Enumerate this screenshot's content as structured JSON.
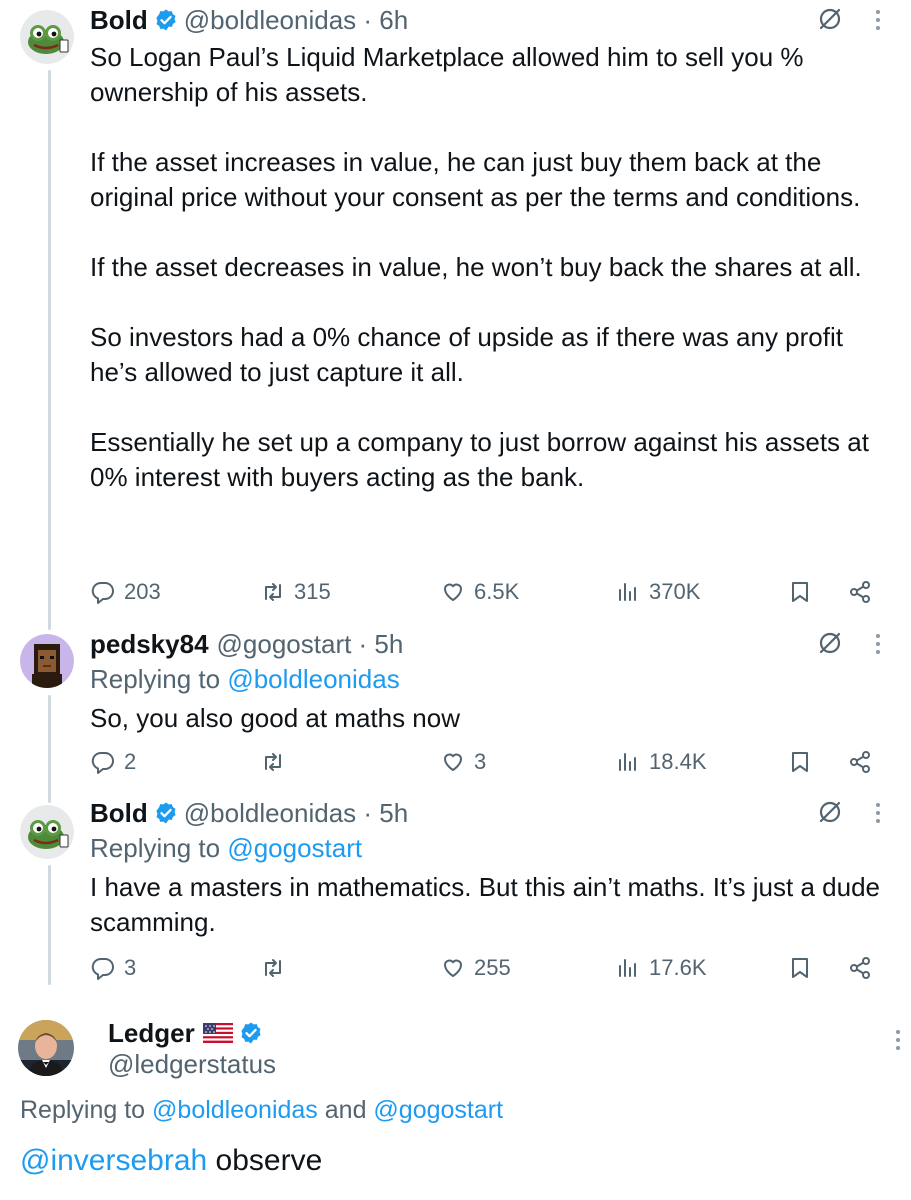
{
  "tweets": [
    {
      "display_name": "Bold",
      "handle_time": "@boldleonidas · 6h",
      "body": [
        "So Logan Paul’s Liquid Marketplace allowed him to sell you % ownership of his assets.",
        "If the asset increases in value, he can just buy them back at the original price without your consent as per the terms and conditions.",
        "If the asset decreases in value, he won’t buy back the shares at all.",
        "So investors had a 0% chance of upside as if there was any profit he’s allowed to just capture it all.",
        "Essentially he set up a company to just borrow against his assets at 0% interest with buyers acting as the bank."
      ],
      "replies": "203",
      "retweets": "315",
      "likes": "6.5K",
      "views": "370K"
    },
    {
      "display_name": "pedsky84",
      "handle_time": "@gogostart · 5h",
      "replying_prefix": "Replying to ",
      "replying_to": "@boldleonidas",
      "body": [
        "So, you also good at maths now"
      ],
      "replies": "2",
      "retweets": "",
      "likes": "3",
      "views": "18.4K"
    },
    {
      "display_name": "Bold",
      "handle_time": "@boldleonidas · 5h",
      "replying_prefix": "Replying to ",
      "replying_to": "@gogostart",
      "body": [
        "I have a masters in mathematics. But this ain’t maths. It’s just a dude scamming."
      ],
      "replies": "3",
      "retweets": "",
      "likes": "255",
      "views": "17.6K"
    }
  ],
  "main_tweet": {
    "display_name": "Ledger",
    "flag_icon": "us-flag-icon",
    "handle": "@ledgerstatus",
    "replying_prefix": "Replying to ",
    "replying_to_1": "@boldleonidas",
    "replying_and": " and ",
    "replying_to_2": "@gogostart",
    "body_mention": "@inversebrah",
    "body_text": " observe"
  },
  "colors": {
    "accent": "#1d9bf0",
    "secondary_text": "#536471",
    "primary_text": "#0f1419",
    "thread_line": "#cfd9de"
  },
  "icons": {
    "reply": "reply-icon",
    "retweet": "retweet-icon",
    "like": "heart-icon",
    "views": "views-icon",
    "bookmark": "bookmark-icon",
    "share": "share-icon",
    "grok": "grok-icon",
    "more": "more-icon",
    "verified": "verified-badge-icon"
  }
}
